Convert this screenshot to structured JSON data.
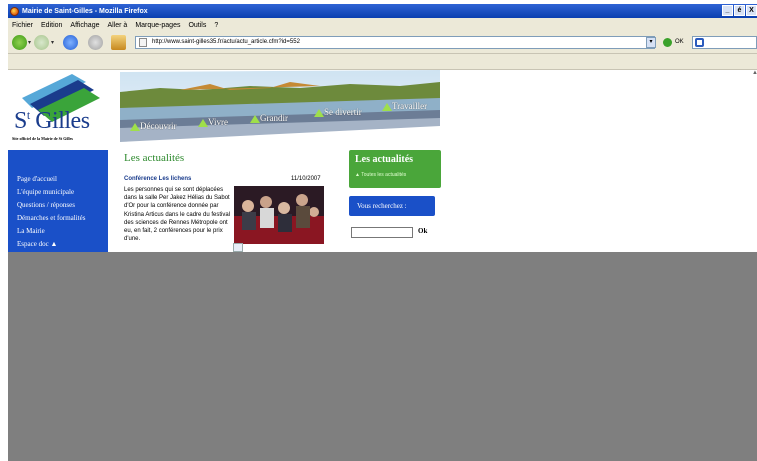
{
  "window": {
    "title": "Mairie de Saint-Gilles - Mozilla Firefox",
    "buttons": [
      "_",
      "é",
      "X"
    ]
  },
  "menu": [
    "Fichier",
    "Edition",
    "Affichage",
    "Aller à",
    "Marque-pages",
    "Outils",
    "?"
  ],
  "toolbar": {
    "url": "http://www.saint-gilles35.fr/actu/actu_article.cfm?id=552",
    "go_label": "OK"
  },
  "site": {
    "logo_title": "St Gilles",
    "logo_title_main": "S",
    "logo_title_sup": "t",
    "logo_title_rest": " Gilles",
    "logo_subtitle": "Site officiel de la Mairie de St Gilles",
    "banner_nav": [
      "Découvrir",
      "Vivre",
      "Grandir",
      "Se divertir",
      "Travailler"
    ],
    "sidebar": [
      "Page d'accueil",
      "L'équipe municipale",
      "Questions / réponses",
      "Démarches et formalités",
      "La Mairie",
      "Espace doc"
    ],
    "news_heading": "Les actualités",
    "article": {
      "title": "Conférence Les lichens",
      "date": "11/10/2007",
      "text": "Les personnes qui se sont déplacées dans la salle Per Jakez Hélias du Sabot d'Or pour la conférence donnée par Kristina Articus dans le cadre du festival des sciences de Rennes Métropole ont eu, en fait, 2 conférences pour le prix d'une."
    },
    "right_box": {
      "heading": "Les actualités",
      "link": "Toutes les actualités"
    },
    "search": {
      "label": "Vous recherchez :",
      "ok": "Ok"
    }
  },
  "colors": {
    "sidebar_blue": "#1a50c8",
    "news_green": "#2e8a2e",
    "overlay_gray": "#7f7f7f"
  }
}
